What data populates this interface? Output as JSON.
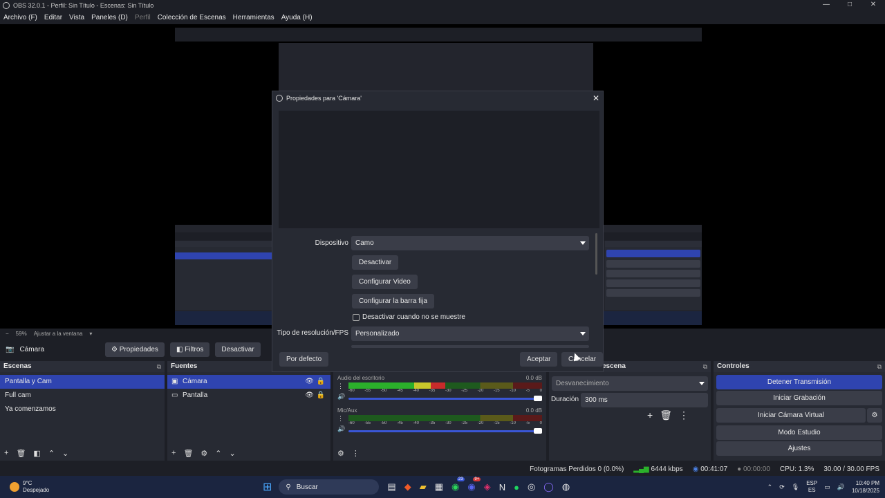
{
  "window": {
    "title": "OBS 32.0.1 - Perfil: Sin Título - Escenas: Sin Título",
    "minimize": "—",
    "maximize": "□",
    "close": "✕"
  },
  "menu": {
    "items": [
      "Archivo (F)",
      "Editar",
      "Vista",
      "Paneles (D)",
      "Perfil",
      "Colección de Escenas",
      "Herramientas",
      "Ayuda (H)"
    ]
  },
  "scalebar": {
    "zoom": "59%",
    "fit": "Ajustar a la ventana"
  },
  "source_toolbar": {
    "source_name": "Cámara",
    "properties": "Propiedades",
    "filters": "Filtros",
    "deactivate": "Desactivar"
  },
  "scenes": {
    "title": "Escenas",
    "items": [
      "Pantalla y Cam",
      "Full cam",
      "Ya comenzamos"
    ]
  },
  "sources": {
    "title": "Fuentes",
    "items": [
      "Cámara",
      "Pantalla"
    ]
  },
  "mixer": {
    "channels": [
      {
        "name": "Audio del escritorio",
        "db": "0.0 dB",
        "level": 0.5
      },
      {
        "name": "Mic/Aux",
        "db": "0.0 dB",
        "level": 0.0
      }
    ],
    "ticks": [
      "-60",
      "-55",
      "-50",
      "-45",
      "-40",
      "-35",
      "-30",
      "-25",
      "-20",
      "-15",
      "-10",
      "-5",
      "0"
    ]
  },
  "transitions": {
    "title": "Transiciones de escena",
    "title_visible": "escena",
    "type": "Desvanecimiento",
    "duration_label": "Duración",
    "duration": "300 ms"
  },
  "controls": {
    "title": "Controles",
    "buttons": [
      "Detener Transmisión",
      "Iniciar Grabación",
      "Iniciar Cámara Virtual",
      "Modo Estudio",
      "Ajustes"
    ]
  },
  "status": {
    "dropped": "Fotogramas Perdidos 0 (0.0%)",
    "bitrate": "6444 kbps",
    "stream_time": "00:41:07",
    "rec_time": "00:00:00",
    "cpu": "CPU: 1.3%",
    "fps": "30.00 / 30.00 FPS"
  },
  "dialog": {
    "title": "Propiedades para 'Cámara'",
    "device_label": "Dispositivo",
    "device_value": "Camo",
    "deactivate": "Desactivar",
    "configure_video": "Configurar Video",
    "configure_crossbar": "Configurar la barra fija",
    "deactivate_hidden": "Desactivar cuando no se muestre",
    "resolution_label": "Tipo de resolución/FPS",
    "resolution_value": "Personalizado",
    "defaults": "Por defecto",
    "ok": "Aceptar",
    "cancel": "Cancelar"
  },
  "taskbar": {
    "weather_temp": "9°C",
    "weather_desc": "Despejado",
    "search": "Buscar",
    "lang": "ESP",
    "lang_sub": "ES",
    "time": "10:40 PM",
    "date": "10/18/2025",
    "badge_whatsapp": "23",
    "badge_discord": "9+"
  }
}
